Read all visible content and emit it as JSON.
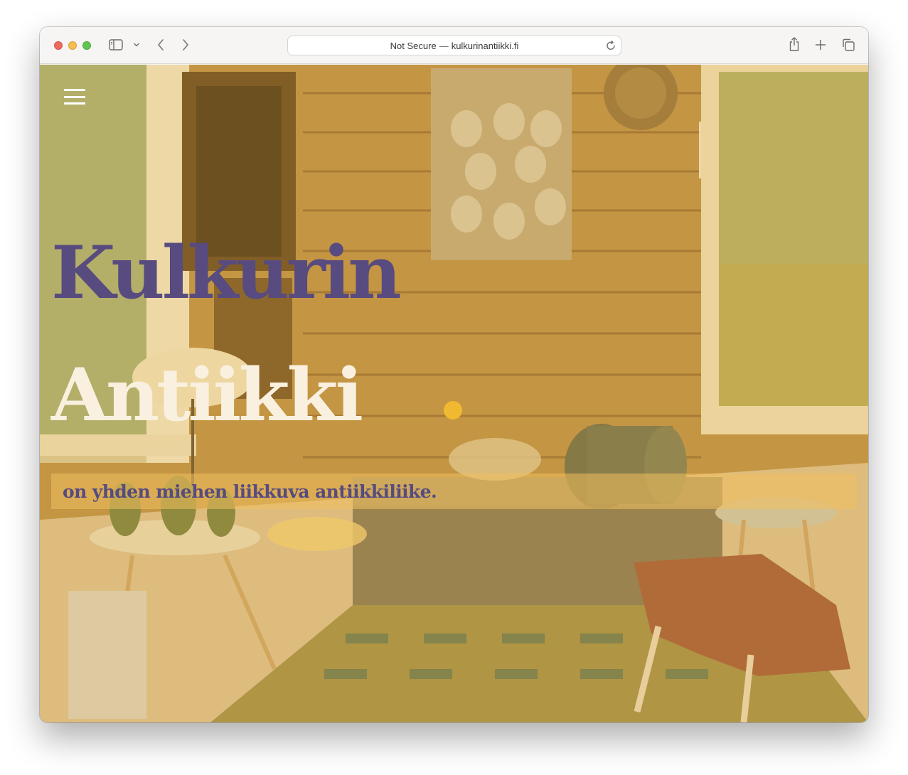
{
  "browser": {
    "address_prefix": "Not Secure",
    "address_separator": "—",
    "address_domain": "kulkurinantiikki.fi"
  },
  "hero": {
    "title_line1": "Kulkurin",
    "title_line2": "Antiikki",
    "tagline": "on yhden miehen liikkuva antiikkiliike."
  },
  "icons": {
    "toolbar": [
      "sidebar-icon",
      "chevron-down-icon",
      "back-icon",
      "forward-icon",
      "share-icon",
      "new-tab-icon",
      "tabs-overview-icon",
      "reload-icon"
    ],
    "page": [
      "hamburger-menu-icon"
    ]
  },
  "colors": {
    "title_purple": "#574b7f",
    "title_cream": "#faf0df",
    "accent_dot": "#f0b930",
    "tagline_band": "#f0c05f",
    "photo_tint": "#e8b23c"
  }
}
